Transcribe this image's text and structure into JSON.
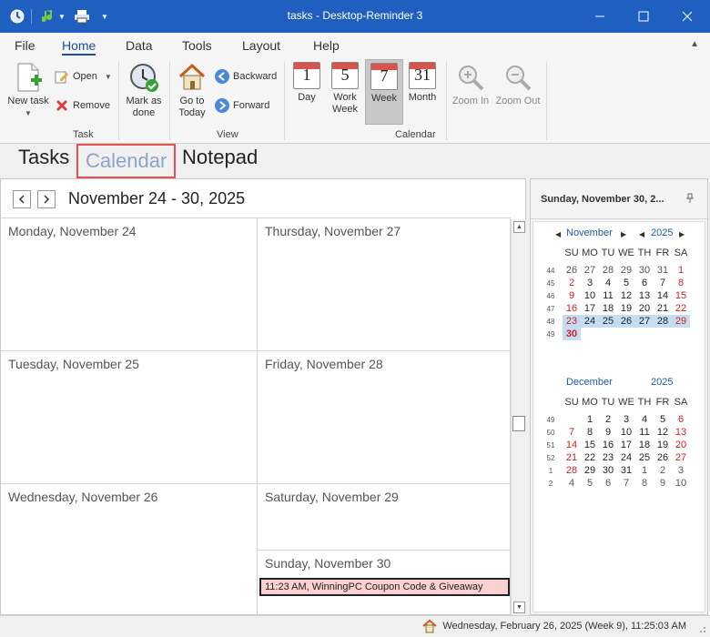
{
  "window": {
    "title": "tasks - Desktop-Reminder 3",
    "quick_access": [
      "app-icon",
      "music-note-icon",
      "printer-icon",
      "dropdown-icon"
    ]
  },
  "menu": {
    "tabs": [
      "File",
      "Home",
      "Data",
      "Tools",
      "Layout",
      "Help"
    ],
    "active": "Home"
  },
  "ribbon": {
    "task_group": {
      "label": "Task",
      "new_task": "New task",
      "open": "Open",
      "remove": "Remove",
      "mark_done_1": "Mark as",
      "mark_done_2": "done"
    },
    "view_group": {
      "label": "View",
      "go_today_1": "Go to",
      "go_today_2": "Today",
      "backward": "Backward",
      "forward": "Forward"
    },
    "calendar_group": {
      "label": "Calendar",
      "day": "Day",
      "day_num": "1",
      "work_week_1": "Work",
      "work_week_2": "Week",
      "work_week_num": "5",
      "week": "Week",
      "week_num": "7",
      "month": "Month",
      "month_num": "31",
      "zoom_in": "Zoom In",
      "zoom_out": "Zoom Out"
    }
  },
  "modules": {
    "tasks": "Tasks",
    "calendar": "Calendar",
    "notepad": "Notepad",
    "active": "Calendar"
  },
  "calendar": {
    "range": "November 24 - 30, 2025",
    "days": {
      "mon": "Monday, November 24",
      "tue": "Tuesday, November 25",
      "wed": "Wednesday, November 26",
      "thu": "Thursday, November 27",
      "fri": "Friday, November 28",
      "sat": "Saturday, November 29",
      "sun": "Sunday, November 30"
    },
    "appointment": "11:23 AM, WinningPC Coupon Code & Giveaway"
  },
  "side_panel": {
    "title": "Sunday, November 30, 2...",
    "dow": [
      "SU",
      "MO",
      "TU",
      "WE",
      "TH",
      "FR",
      "SA"
    ],
    "month1": {
      "name": "November",
      "year": "2025",
      "weeks": [
        {
          "wk": "44",
          "days": [
            "26",
            "27",
            "28",
            "29",
            "30",
            "31",
            "1"
          ]
        },
        {
          "wk": "45",
          "days": [
            "2",
            "3",
            "4",
            "5",
            "6",
            "7",
            "8"
          ]
        },
        {
          "wk": "46",
          "days": [
            "9",
            "10",
            "11",
            "12",
            "13",
            "14",
            "15"
          ]
        },
        {
          "wk": "47",
          "days": [
            "16",
            "17",
            "18",
            "19",
            "20",
            "21",
            "22"
          ]
        },
        {
          "wk": "48",
          "days": [
            "23",
            "24",
            "25",
            "26",
            "27",
            "28",
            "29"
          ]
        },
        {
          "wk": "49",
          "days": [
            "30"
          ]
        }
      ]
    },
    "month2": {
      "name": "December",
      "year": "2025",
      "weeks": [
        {
          "wk": "49",
          "days": [
            "",
            "1",
            "2",
            "3",
            "4",
            "5",
            "6"
          ]
        },
        {
          "wk": "50",
          "days": [
            "7",
            "8",
            "9",
            "10",
            "11",
            "12",
            "13"
          ]
        },
        {
          "wk": "51",
          "days": [
            "14",
            "15",
            "16",
            "17",
            "18",
            "19",
            "20"
          ]
        },
        {
          "wk": "52",
          "days": [
            "21",
            "22",
            "23",
            "24",
            "25",
            "26",
            "27"
          ]
        },
        {
          "wk": "1",
          "days": [
            "28",
            "29",
            "30",
            "31",
            "1",
            "2",
            "3"
          ]
        },
        {
          "wk": "2",
          "days": [
            "4",
            "5",
            "6",
            "7",
            "8",
            "9",
            "10"
          ]
        }
      ]
    }
  },
  "status": {
    "text": "Wednesday, February 26, 2025 (Week 9), 11:25:03 AM"
  },
  "colors": {
    "titlebar": "#1f5fbf",
    "accent": "#1a4fa0",
    "weekend_red": "#d02020",
    "selection": "#c6dcf2",
    "appointment_bg": "#fbd0d0"
  }
}
